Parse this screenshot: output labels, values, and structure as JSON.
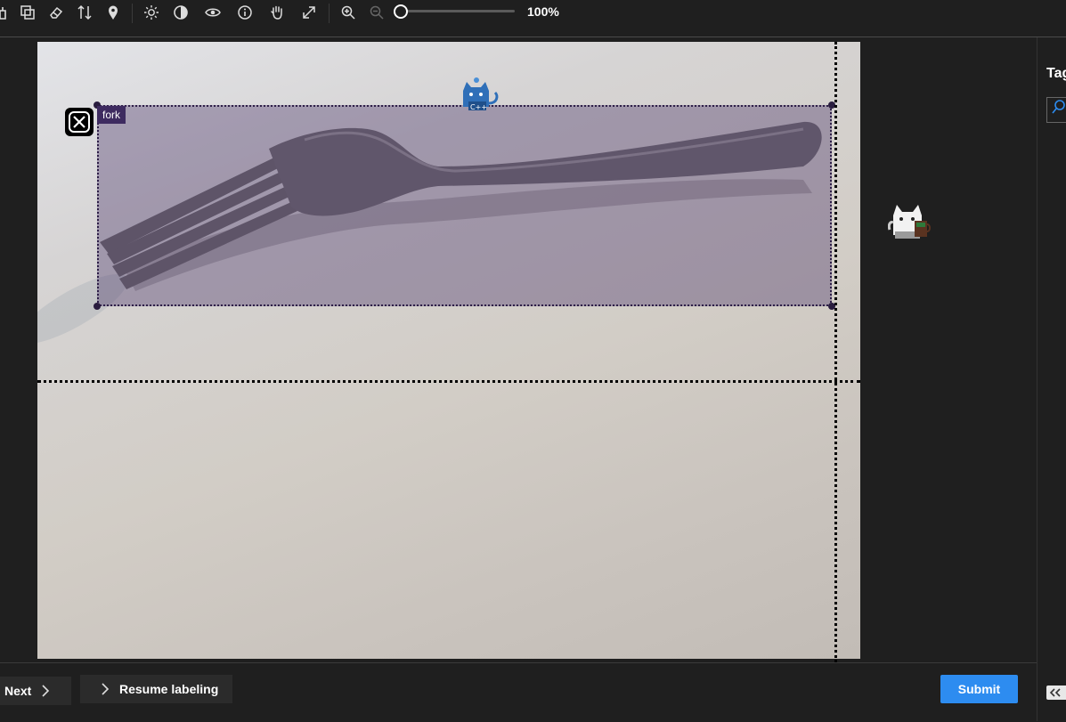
{
  "toolbar": {
    "icons": [
      "pan-icon",
      "copy-icon",
      "eraser-icon",
      "sort-icon",
      "location-pin-icon",
      "brightness-icon",
      "contrast-icon",
      "eye-icon",
      "info-icon",
      "hand-icon",
      "expand-icon",
      "zoom-in-icon",
      "zoom-out-icon"
    ],
    "zoom_value": "100%",
    "zoom_level": 0
  },
  "canvas": {
    "annotation_label": "fork"
  },
  "right_panel": {
    "tags_title": "Tag"
  },
  "bottom_bar": {
    "next_label": "Next",
    "resume_label": "Resume labeling",
    "submit_label": "Submit"
  },
  "colors": {
    "accent": "#2d8cf0",
    "label_bg": "#3e2b60",
    "background": "#1f1f1f"
  }
}
